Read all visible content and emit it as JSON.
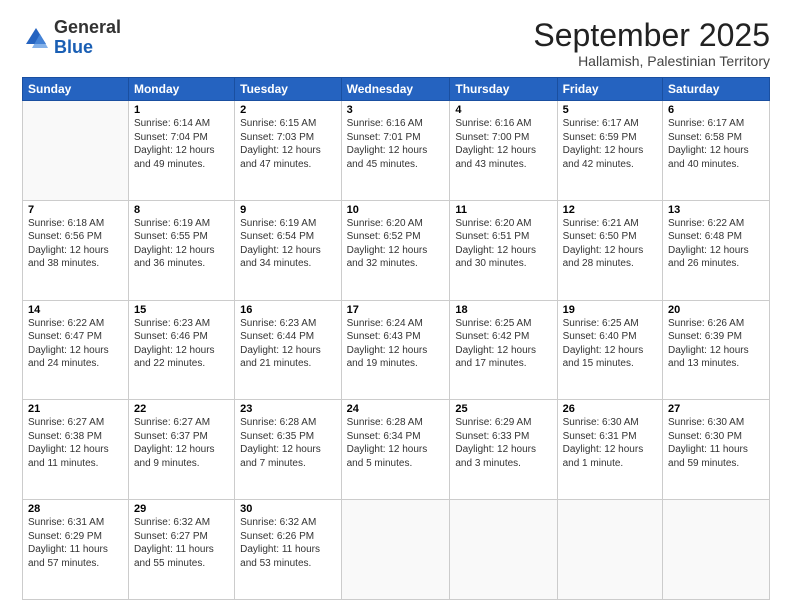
{
  "logo": {
    "general": "General",
    "blue": "Blue"
  },
  "header": {
    "month": "September 2025",
    "location": "Hallamish, Palestinian Territory"
  },
  "weekdays": [
    "Sunday",
    "Monday",
    "Tuesday",
    "Wednesday",
    "Thursday",
    "Friday",
    "Saturday"
  ],
  "weeks": [
    [
      {
        "day": "",
        "sunrise": "",
        "sunset": "",
        "daylight": ""
      },
      {
        "day": "1",
        "sunrise": "Sunrise: 6:14 AM",
        "sunset": "Sunset: 7:04 PM",
        "daylight": "Daylight: 12 hours and 49 minutes."
      },
      {
        "day": "2",
        "sunrise": "Sunrise: 6:15 AM",
        "sunset": "Sunset: 7:03 PM",
        "daylight": "Daylight: 12 hours and 47 minutes."
      },
      {
        "day": "3",
        "sunrise": "Sunrise: 6:16 AM",
        "sunset": "Sunset: 7:01 PM",
        "daylight": "Daylight: 12 hours and 45 minutes."
      },
      {
        "day": "4",
        "sunrise": "Sunrise: 6:16 AM",
        "sunset": "Sunset: 7:00 PM",
        "daylight": "Daylight: 12 hours and 43 minutes."
      },
      {
        "day": "5",
        "sunrise": "Sunrise: 6:17 AM",
        "sunset": "Sunset: 6:59 PM",
        "daylight": "Daylight: 12 hours and 42 minutes."
      },
      {
        "day": "6",
        "sunrise": "Sunrise: 6:17 AM",
        "sunset": "Sunset: 6:58 PM",
        "daylight": "Daylight: 12 hours and 40 minutes."
      }
    ],
    [
      {
        "day": "7",
        "sunrise": "Sunrise: 6:18 AM",
        "sunset": "Sunset: 6:56 PM",
        "daylight": "Daylight: 12 hours and 38 minutes."
      },
      {
        "day": "8",
        "sunrise": "Sunrise: 6:19 AM",
        "sunset": "Sunset: 6:55 PM",
        "daylight": "Daylight: 12 hours and 36 minutes."
      },
      {
        "day": "9",
        "sunrise": "Sunrise: 6:19 AM",
        "sunset": "Sunset: 6:54 PM",
        "daylight": "Daylight: 12 hours and 34 minutes."
      },
      {
        "day": "10",
        "sunrise": "Sunrise: 6:20 AM",
        "sunset": "Sunset: 6:52 PM",
        "daylight": "Daylight: 12 hours and 32 minutes."
      },
      {
        "day": "11",
        "sunrise": "Sunrise: 6:20 AM",
        "sunset": "Sunset: 6:51 PM",
        "daylight": "Daylight: 12 hours and 30 minutes."
      },
      {
        "day": "12",
        "sunrise": "Sunrise: 6:21 AM",
        "sunset": "Sunset: 6:50 PM",
        "daylight": "Daylight: 12 hours and 28 minutes."
      },
      {
        "day": "13",
        "sunrise": "Sunrise: 6:22 AM",
        "sunset": "Sunset: 6:48 PM",
        "daylight": "Daylight: 12 hours and 26 minutes."
      }
    ],
    [
      {
        "day": "14",
        "sunrise": "Sunrise: 6:22 AM",
        "sunset": "Sunset: 6:47 PM",
        "daylight": "Daylight: 12 hours and 24 minutes."
      },
      {
        "day": "15",
        "sunrise": "Sunrise: 6:23 AM",
        "sunset": "Sunset: 6:46 PM",
        "daylight": "Daylight: 12 hours and 22 minutes."
      },
      {
        "day": "16",
        "sunrise": "Sunrise: 6:23 AM",
        "sunset": "Sunset: 6:44 PM",
        "daylight": "Daylight: 12 hours and 21 minutes."
      },
      {
        "day": "17",
        "sunrise": "Sunrise: 6:24 AM",
        "sunset": "Sunset: 6:43 PM",
        "daylight": "Daylight: 12 hours and 19 minutes."
      },
      {
        "day": "18",
        "sunrise": "Sunrise: 6:25 AM",
        "sunset": "Sunset: 6:42 PM",
        "daylight": "Daylight: 12 hours and 17 minutes."
      },
      {
        "day": "19",
        "sunrise": "Sunrise: 6:25 AM",
        "sunset": "Sunset: 6:40 PM",
        "daylight": "Daylight: 12 hours and 15 minutes."
      },
      {
        "day": "20",
        "sunrise": "Sunrise: 6:26 AM",
        "sunset": "Sunset: 6:39 PM",
        "daylight": "Daylight: 12 hours and 13 minutes."
      }
    ],
    [
      {
        "day": "21",
        "sunrise": "Sunrise: 6:27 AM",
        "sunset": "Sunset: 6:38 PM",
        "daylight": "Daylight: 12 hours and 11 minutes."
      },
      {
        "day": "22",
        "sunrise": "Sunrise: 6:27 AM",
        "sunset": "Sunset: 6:37 PM",
        "daylight": "Daylight: 12 hours and 9 minutes."
      },
      {
        "day": "23",
        "sunrise": "Sunrise: 6:28 AM",
        "sunset": "Sunset: 6:35 PM",
        "daylight": "Daylight: 12 hours and 7 minutes."
      },
      {
        "day": "24",
        "sunrise": "Sunrise: 6:28 AM",
        "sunset": "Sunset: 6:34 PM",
        "daylight": "Daylight: 12 hours and 5 minutes."
      },
      {
        "day": "25",
        "sunrise": "Sunrise: 6:29 AM",
        "sunset": "Sunset: 6:33 PM",
        "daylight": "Daylight: 12 hours and 3 minutes."
      },
      {
        "day": "26",
        "sunrise": "Sunrise: 6:30 AM",
        "sunset": "Sunset: 6:31 PM",
        "daylight": "Daylight: 12 hours and 1 minute."
      },
      {
        "day": "27",
        "sunrise": "Sunrise: 6:30 AM",
        "sunset": "Sunset: 6:30 PM",
        "daylight": "Daylight: 11 hours and 59 minutes."
      }
    ],
    [
      {
        "day": "28",
        "sunrise": "Sunrise: 6:31 AM",
        "sunset": "Sunset: 6:29 PM",
        "daylight": "Daylight: 11 hours and 57 minutes."
      },
      {
        "day": "29",
        "sunrise": "Sunrise: 6:32 AM",
        "sunset": "Sunset: 6:27 PM",
        "daylight": "Daylight: 11 hours and 55 minutes."
      },
      {
        "day": "30",
        "sunrise": "Sunrise: 6:32 AM",
        "sunset": "Sunset: 6:26 PM",
        "daylight": "Daylight: 11 hours and 53 minutes."
      },
      {
        "day": "",
        "sunrise": "",
        "sunset": "",
        "daylight": ""
      },
      {
        "day": "",
        "sunrise": "",
        "sunset": "",
        "daylight": ""
      },
      {
        "day": "",
        "sunrise": "",
        "sunset": "",
        "daylight": ""
      },
      {
        "day": "",
        "sunrise": "",
        "sunset": "",
        "daylight": ""
      }
    ]
  ]
}
